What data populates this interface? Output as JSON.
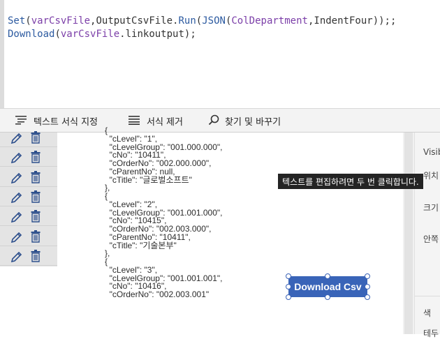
{
  "formula": {
    "line1": {
      "fn1": "Set",
      "p1": "(",
      "var1": "varCsvFile",
      "p2": ",",
      "obj": "OutputCsvFile",
      "p3": ".",
      "run": "Run",
      "p4": "(",
      "json": "JSON",
      "p5": "(",
      "col": "ColDepartment",
      "p6": ",",
      "indent": "IndentFour",
      "p7": "));",
      "p8": ";"
    },
    "line2": {
      "fn": "Download",
      "p1": "(",
      "var": "varCsvFile",
      "p2": ".",
      "prop": "linkoutput",
      "p3": ");"
    }
  },
  "toolbar": {
    "format_text": "텍스트 서식 지정",
    "remove_format": "서식 제거",
    "find_replace": "찾기 및 바꾸기"
  },
  "json_preview": [
    "{",
    "  \"cLevel\": \"1\",",
    "  \"cLevelGroup\": \"001.000.000\",",
    "  \"cNo\": \"10411\",",
    "  \"cOrderNo\": \"002.000.000\",",
    "  \"cParentNo\": null,",
    "  \"cTitle\": \"글로벌소프트\"",
    "},",
    "{",
    "  \"cLevel\": \"2\",",
    "  \"cLevelGroup\": \"001.001.000\",",
    "  \"cNo\": \"10415\",",
    "  \"cOrderNo\": \"002.003.000\",",
    "  \"cParentNo\": \"10411\",",
    "  \"cTitle\": \"기술본부\"",
    "},",
    "{",
    "  \"cLevel\": \"3\",",
    "  \"cLevelGroup\": \"001.001.001\",",
    "  \"cNo\": \"10416\",",
    "  \"cOrderNo\": \"002.003.001\""
  ],
  "tooltip": "텍스트를 편집하려면 두 번 클릭합니다.",
  "download_button": "Download Csv",
  "right_panel": {
    "labels": [
      "Visib",
      "위치",
      "크기",
      "안쪽",
      "색",
      "테두"
    ]
  },
  "colors": {
    "button": "#3964b8",
    "formula_function": "#2c5aa0",
    "formula_identifier": "#7b3ea8"
  },
  "row_count": 7
}
